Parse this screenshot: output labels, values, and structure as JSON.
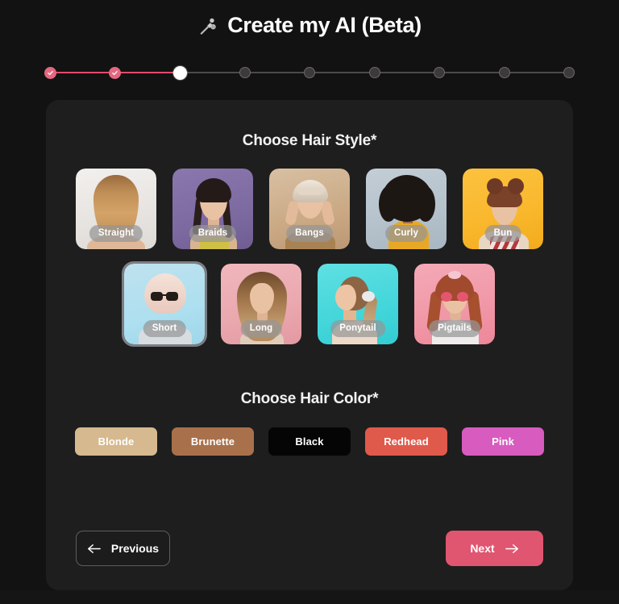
{
  "header": {
    "icon": "magic-pen-icon",
    "title": "Create my AI (Beta)"
  },
  "stepper": {
    "total_steps": 9,
    "current_step": 3,
    "completed_steps": 2,
    "accent_color": "#e4687f",
    "track_color": "#4a4a4a",
    "active_color": "#ffffff",
    "steps": [
      {
        "index": 1,
        "state": "done"
      },
      {
        "index": 2,
        "state": "done"
      },
      {
        "index": 3,
        "state": "active"
      },
      {
        "index": 4,
        "state": "pending"
      },
      {
        "index": 5,
        "state": "pending"
      },
      {
        "index": 6,
        "state": "pending"
      },
      {
        "index": 7,
        "state": "pending"
      },
      {
        "index": 8,
        "state": "pending"
      },
      {
        "index": 9,
        "state": "pending"
      }
    ]
  },
  "hair_style": {
    "title": "Choose Hair Style*",
    "row1": [
      {
        "label": "Straight",
        "selected": false
      },
      {
        "label": "Braids",
        "selected": false
      },
      {
        "label": "Bangs",
        "selected": false
      },
      {
        "label": "Curly",
        "selected": false
      },
      {
        "label": "Bun",
        "selected": false
      }
    ],
    "row2": [
      {
        "label": "Short",
        "selected": true
      },
      {
        "label": "Long",
        "selected": false
      },
      {
        "label": "Ponytail",
        "selected": false
      },
      {
        "label": "Pigtails",
        "selected": false
      }
    ]
  },
  "hair_color": {
    "title": "Choose Hair Color*",
    "options": [
      {
        "label": "Blonde",
        "color": "#d7b98f",
        "text_color": "#ffffff"
      },
      {
        "label": "Brunette",
        "color": "#a9714b",
        "text_color": "#ffffff"
      },
      {
        "label": "Black",
        "color": "#050505",
        "text_color": "#ffffff"
      },
      {
        "label": "Redhead",
        "color": "#e05a4c",
        "text_color": "#ffffff"
      },
      {
        "label": "Pink",
        "color": "#d85bc0",
        "text_color": "#ffffff"
      }
    ]
  },
  "navigation": {
    "previous_label": "Previous",
    "previous_icon": "arrow-left-icon",
    "next_label": "Next",
    "next_icon": "arrow-right-icon",
    "next_color": "#e05570"
  }
}
